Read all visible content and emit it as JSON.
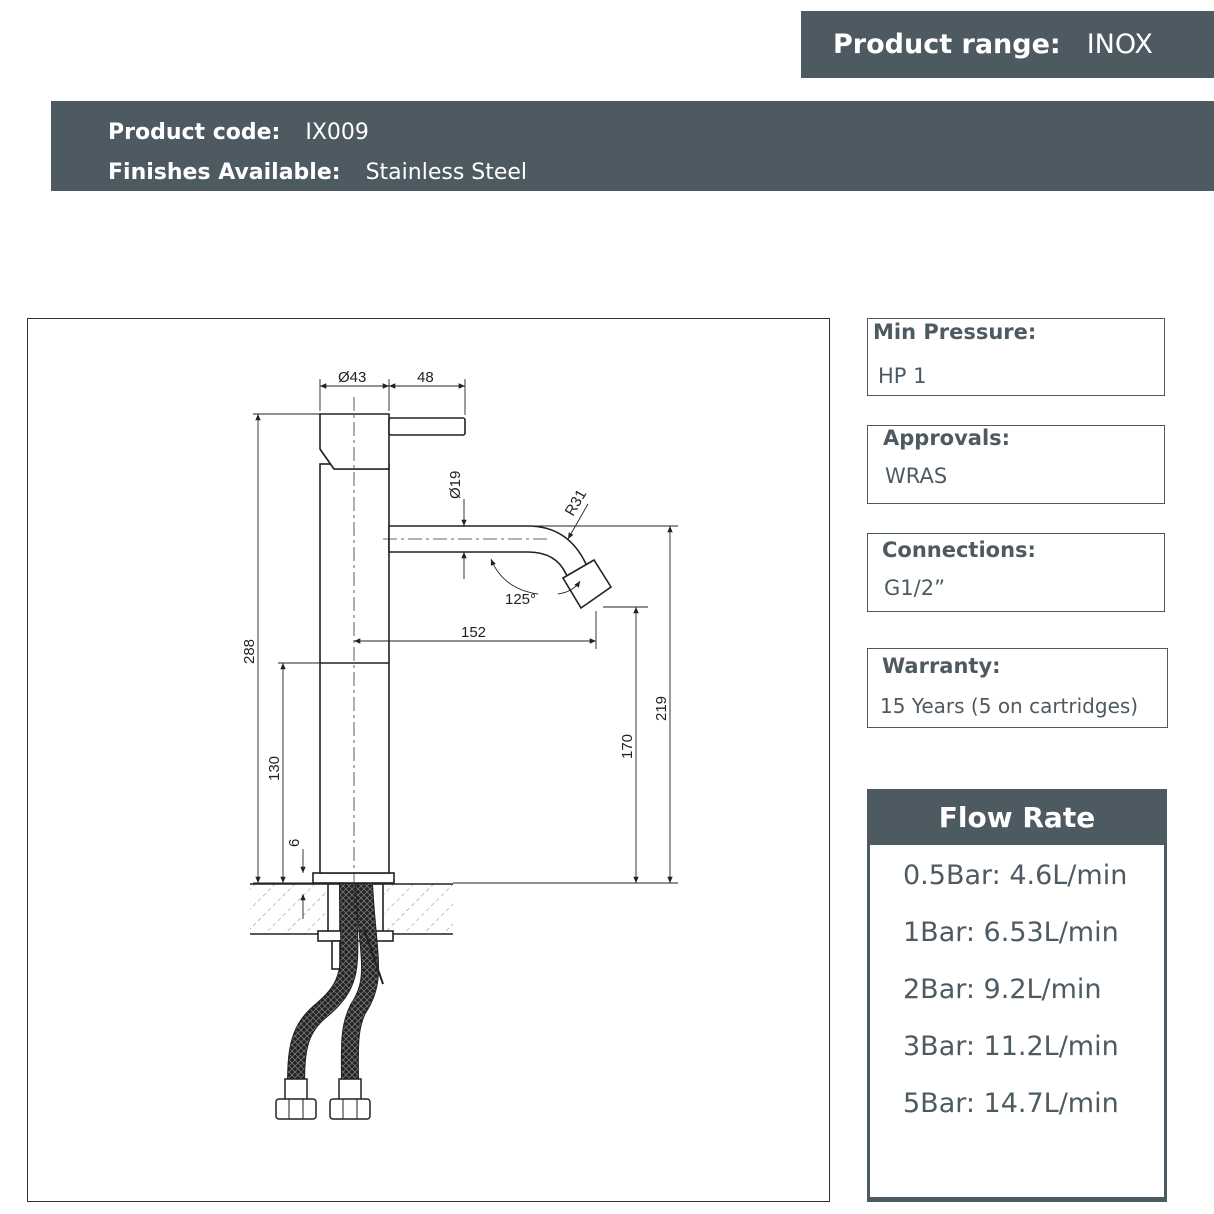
{
  "header": {
    "range_label": "Product range:",
    "range_value": "INOX",
    "code_label": "Product code:",
    "code_value": "IX009",
    "finish_label": "Finishes Available:",
    "finish_value": "Stainless Steel"
  },
  "drawing": {
    "dims": {
      "d43": "Ø43",
      "d48": "48",
      "d19": "Ø19",
      "r31": "R31",
      "a125": "125°",
      "d152": "152",
      "d288": "288",
      "d130": "130",
      "d6": "6",
      "d170": "170",
      "d219": "219"
    }
  },
  "specs": {
    "min_pressure": {
      "title": "Min Pressure:",
      "value": "HP 1"
    },
    "approvals": {
      "title": "Approvals:",
      "value": "WRAS"
    },
    "connections": {
      "title": "Connections:",
      "value": "G1/2”"
    },
    "warranty": {
      "title": "Warranty:",
      "value": "15 Years (5 on cartridges)"
    }
  },
  "flow_rate": {
    "title": "Flow Rate",
    "rows": [
      "0.5Bar:  4.6L/min",
      "1Bar:  6.53L/min",
      "2Bar:  9.2L/min",
      "3Bar:  11.2L/min",
      "5Bar:  14.7L/min"
    ]
  },
  "colors": {
    "brand_slate": "#4e5a62",
    "text_white": "#ffffff"
  }
}
